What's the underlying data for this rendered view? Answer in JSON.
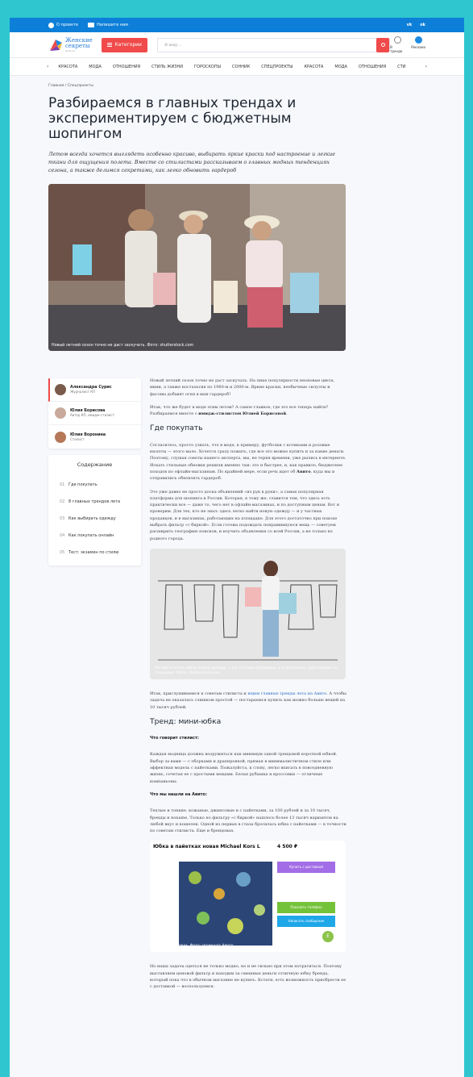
{
  "topbar": {
    "about": "О проекте",
    "write": "Напишите нам",
    "vk": "vk",
    "ok": "ok"
  },
  "header": {
    "logo_line1": "Женские",
    "logo_line2": "секреты",
    "logo_sub": "Avito.ru",
    "categories_label": "Категории",
    "search_placeholder": "Я ищу...",
    "trends_label": "В тренде",
    "ads_label": "Реклама"
  },
  "nav": {
    "items": [
      "КРАСОТА",
      "МОДА",
      "ОТНОШЕНИЯ",
      "СТИЛЬ ЖИЗНИ",
      "ГОРОСКОПЫ",
      "СОННИК",
      "СПЕЦПРОЕКТЫ",
      "КРАСОТА",
      "МОДА",
      "ОТНОШЕНИЯ",
      "СТИ"
    ]
  },
  "article": {
    "breadcrumb": "Главная / Спецпроекты",
    "title": "Разбираемся в главных трендах и экспериментируем с бюджетным шопингом",
    "lead": "Летом всегда хочется выглядеть особенно красиво, выбирать яркие краски под настроение и легкие ткани для ощущения полета. Вместе со стилистами рассказываем о главных модных тенденциях сезона, а также делимся секретами, как легко обновить гардероб",
    "hero_caption": "Новый летний сезон точно не даст заскучать. Фото: shutterstock.com"
  },
  "authors": [
    {
      "name": "Александра Сурис",
      "role": "Журналист КП"
    },
    {
      "name": "Юлия Борисова",
      "role": "Автор КП, имидж-стилист"
    },
    {
      "name": "Юлия Воронина",
      "role": "Стилист"
    }
  ],
  "toc": {
    "title": "Содержание",
    "items": [
      {
        "num": "01",
        "label": "Где покупать"
      },
      {
        "num": "02",
        "label": "8 главных трендов лета"
      },
      {
        "num": "03",
        "label": "Как выбирать одежду"
      },
      {
        "num": "04",
        "label": "Как покупать онлайн"
      },
      {
        "num": "05",
        "label": "Тест: экзамен по стилю"
      }
    ]
  },
  "body": {
    "p1": "Новый летний сезон точно не даст заскучать. На пике популярности неоновые цвета, мини, а также ностальгия по 1980-м и 2000-м. Яркие краски, необычные силуэты и фасоны добавят огня в ваш гардероб!",
    "p2_start": "Итак, что же будет в моде этим летом? А самое главное, где это все теперь найти? Разбираемся вместе с ",
    "p2_bold": "имидж-стилистом Юлией Борисовой",
    "p2_end": ".",
    "h_where": "Где покупать",
    "p3_start": "Согласитесь, просто узнать, что в моде, к примеру, футболки с котиками и розовые кюлоты — этого мало. Хочется сразу пожить, где все это можно купить и за какие деньги. Поэтому, слушая советы нашего эксперта, мы, не теряя времени, уже рылись в интернете. Искать стильные обновки решили именно там: это и быстрее, и, как правило, бюджетнее походов по офлайн-магазинам. По крайней мере, если речь идет об ",
    "p3_bold": "Авито",
    "p3_end": ", куда мы и отправились обновлять гардероб.",
    "p4": "Это уже давно не просто доска объявлений «из рук в руки», а самая популярная платформа для шопинга в России. Которая, к тому же, славится тем, что здесь есть практически все — даже то, чего нет в офлайн-магазинах, и по доступным ценам. Вот и проверим. Для тех, кто не знал: здесь легко найти новую одежду — и у частных продавцов, и в магазинах, работающих на площадке. Для этого достаточно при поиске выбрать фильтр «с биркой». Если готовы подождать понравившуюся вещь — советуем расширить географию поисков, и изучить объявления со всей России, а не только из родного города.",
    "img2_caption": "На Авито легко найти новую одежду — и у частных продавцов, и в магазинах, работающих на площадке. Фото: shutterstock.com",
    "p5_start": "Итак, прислушиваемся к советам стилиста и ",
    "p5_link": "ищем главные тренды лета на Авито",
    "p5_end": ". А чтобы задача не оказалась слишком простой — постараемся купить как можно больше вещей на 10 тысяч рублей.",
    "h_trend": "Тренд: мини-юбка",
    "h_stylist": "Что говорит стилист:",
    "p6": "Каждая модница должна вооружиться как минимум одной трендовой короткой юбкой. Выбор за вами — с оборками и драпировкой, прямая в минималистичном стиле или эффектная модель с пайетками. Пожалуйста, к слову, легко вписать в повседневную жизнь, сочетая ее с простыми вещами. Белая рубашка и кроссовки — отличные компаньоны.",
    "h_found": "Что мы нашли на Авито:",
    "p7": "Теплые и тонкие, кожаные, джинсовые и с пайетками, за 100 рублей и за 10 тысяч, бренды и noname. Только по фильтру «с биркой» нашлось более 13 тысяч вариантов на любой вкус и кошелек. Одной из первых в глаза бросилась юбка с пайетками — в точности по советам стилиста. Еще и брендовая.",
    "img3_caption": "Юбка в пайетках. Фото: скриншот Авито",
    "listing_title": "Юбка в пайетках новая Michael Kors L",
    "listing_price": "4 500 ₽",
    "listing_btn_buy": "Купить с доставкой",
    "listing_btn_call": "Показать телефон",
    "listing_btn_msg": "Написать сообщение",
    "listing_seller_initial": "E",
    "p8": "Но наша задача одеться не только модно, но и не сильно при этом потратиться. Поэтому выставляем ценовой фильтр и находим за смешные деньги отличную юбку бренда, который пока что в обычном магазине не купить. Кстати, есть возможность приобрести ее с доставкой — воспользуемся."
  },
  "colors": {
    "accent_blue": "#0d7fd8",
    "accent_red": "#f04a4a",
    "frame_bg": "#2fc6cf"
  }
}
